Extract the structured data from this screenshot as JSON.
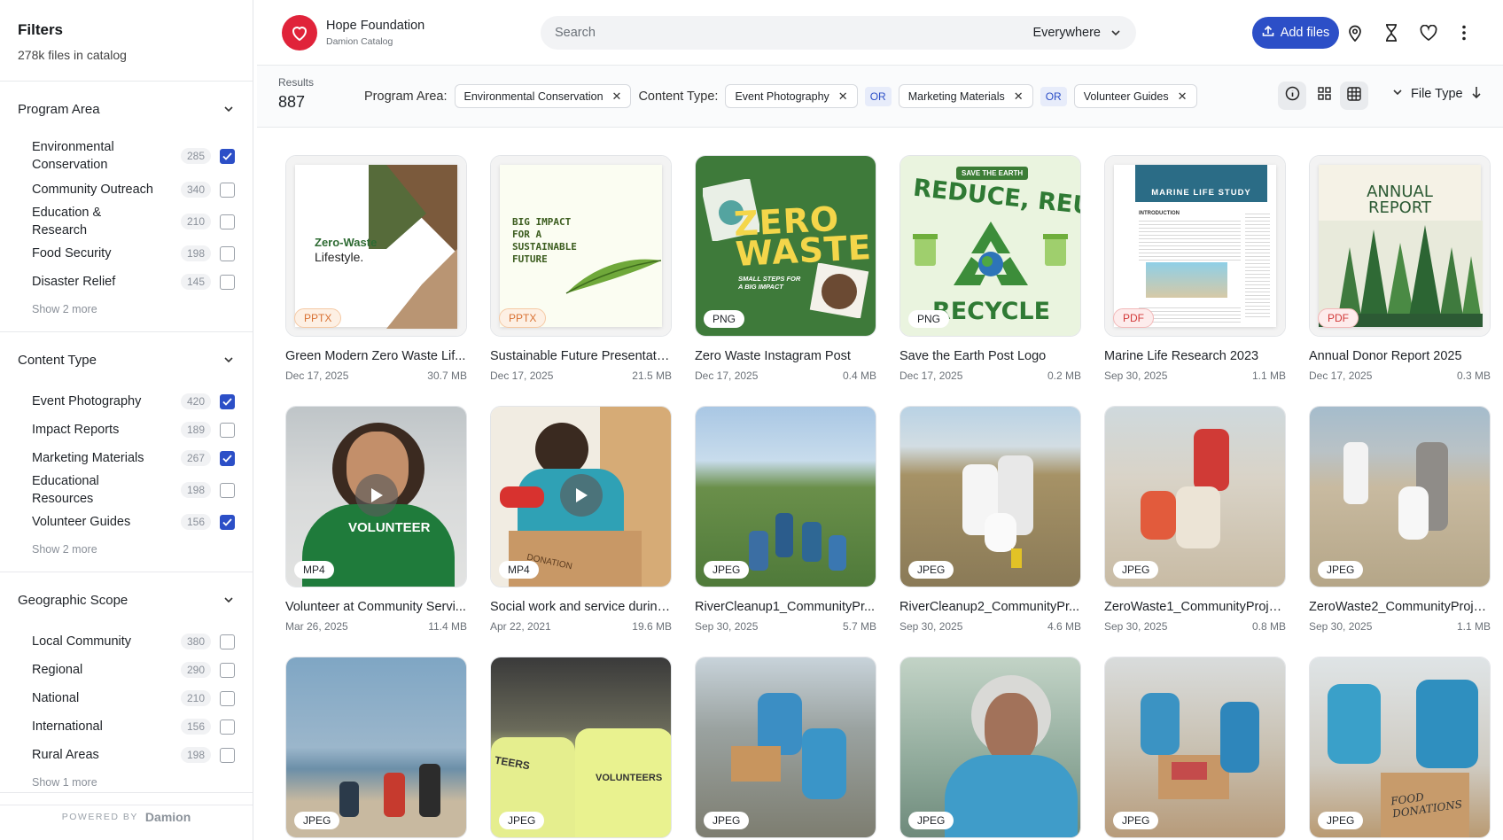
{
  "sidebar": {
    "title": "Filters",
    "subtitle": "278k files in catalog",
    "groups": [
      {
        "title": "Program Area",
        "items": [
          {
            "label": "Environmental Conservation",
            "count": "285",
            "checked": true
          },
          {
            "label": "Community Outreach",
            "count": "340",
            "checked": false
          },
          {
            "label": "Education & Research",
            "count": "210",
            "checked": false
          },
          {
            "label": "Food Security",
            "count": "198",
            "checked": false
          },
          {
            "label": "Disaster Relief",
            "count": "145",
            "checked": false
          }
        ],
        "more": "Show 2 more"
      },
      {
        "title": "Content Type",
        "items": [
          {
            "label": "Event Photography",
            "count": "420",
            "checked": true
          },
          {
            "label": "Impact Reports",
            "count": "189",
            "checked": false
          },
          {
            "label": "Marketing Materials",
            "count": "267",
            "checked": true
          },
          {
            "label": "Educational Resources",
            "count": "198",
            "checked": false
          },
          {
            "label": "Volunteer Guides",
            "count": "156",
            "checked": true
          }
        ],
        "more": "Show 2 more"
      },
      {
        "title": "Geographic Scope",
        "items": [
          {
            "label": "Local Community",
            "count": "380",
            "checked": false
          },
          {
            "label": "Regional",
            "count": "290",
            "checked": false
          },
          {
            "label": "National",
            "count": "210",
            "checked": false
          },
          {
            "label": "International",
            "count": "156",
            "checked": false
          },
          {
            "label": "Rural Areas",
            "count": "198",
            "checked": false
          }
        ],
        "more": "Show 1 more"
      }
    ],
    "footer": {
      "powered_by": "POWERED BY",
      "brand": "Damion"
    }
  },
  "header": {
    "org_name": "Hope Foundation",
    "catalog": "Damion Catalog",
    "search_placeholder": "Search",
    "scope": "Everywhere",
    "add_label": "Add files",
    "icons": [
      "location-pin-icon",
      "hourglass-icon",
      "heart-icon",
      "more-vertical-icon"
    ]
  },
  "filterbar": {
    "results_label": "Results",
    "results_count": "887",
    "program_label": "Program Area:",
    "program_chips": [
      "Environmental Conservation"
    ],
    "content_label": "Content Type:",
    "content_chips": [
      "Event Photography",
      "Marketing Materials",
      "Volunteer Guides"
    ],
    "or_label": "OR",
    "sort_label": "File Type"
  },
  "files": [
    {
      "name": "Green Modern Zero Waste Lif...",
      "date": "Dec 17, 2025",
      "size": "30.7 MB",
      "type": "PPTX",
      "thumb_text": [
        "Zero-Waste",
        "Lifestyle."
      ]
    },
    {
      "name": "Sustainable Future Presentation",
      "date": "Dec 17, 2025",
      "size": "21.5 MB",
      "type": "PPTX",
      "thumb_text": [
        "BIG IMPACT",
        "FOR A",
        "SUSTAINABLE",
        "FUTURE"
      ]
    },
    {
      "name": "Zero Waste Instagram Post",
      "date": "Dec 17, 2025",
      "size": "0.4 MB",
      "type": "PNG",
      "thumb_text": [
        "ZERO",
        "WASTE",
        "SMALL STEPS FOR",
        "A BIG IMPACT"
      ]
    },
    {
      "name": "Save the Earth Post Logo",
      "date": "Dec 17, 2025",
      "size": "0.2 MB",
      "type": "PNG",
      "thumb_text": [
        "SAVE THE EARTH",
        "REDUCE, REUSE",
        "RECYCLE"
      ]
    },
    {
      "name": "Marine Life Research 2023",
      "date": "Sep 30, 2025",
      "size": "1.1 MB",
      "type": "PDF",
      "thumb_text": [
        "MARINE LIFE STUDY",
        "INTRODUCTION"
      ]
    },
    {
      "name": "Annual Donor Report 2025",
      "date": "Dec 17, 2025",
      "size": "0.3 MB",
      "type": "PDF",
      "thumb_text": [
        "ANNUAL",
        "REPORT"
      ]
    },
    {
      "name": "Volunteer at Community Servi...",
      "date": "Mar 26, 2025",
      "size": "11.4 MB",
      "type": "MP4",
      "thumb_text": [
        "VOLUNTEER"
      ]
    },
    {
      "name": "Social work and service during...",
      "date": "Apr 22, 2021",
      "size": "19.6 MB",
      "type": "MP4",
      "thumb_text": [
        "DONATION"
      ]
    },
    {
      "name": "RiverCleanup1_CommunityPr...",
      "date": "Sep 30, 2025",
      "size": "5.7 MB",
      "type": "JPEG"
    },
    {
      "name": "RiverCleanup2_CommunityPr...",
      "date": "Sep 30, 2025",
      "size": "4.6 MB",
      "type": "JPEG"
    },
    {
      "name": "ZeroWaste1_CommunityProje...",
      "date": "Sep 30, 2025",
      "size": "0.8 MB",
      "type": "JPEG"
    },
    {
      "name": "ZeroWaste2_CommunityProje...",
      "date": "Sep 30, 2025",
      "size": "1.1 MB",
      "type": "JPEG"
    },
    {
      "name": "",
      "date": "",
      "size": "",
      "type": "JPEG"
    },
    {
      "name": "",
      "date": "",
      "size": "",
      "type": "JPEG",
      "thumb_text": [
        "TEERS",
        "VOLUNTEERS"
      ]
    },
    {
      "name": "",
      "date": "",
      "size": "",
      "type": "JPEG"
    },
    {
      "name": "",
      "date": "",
      "size": "",
      "type": "JPEG"
    },
    {
      "name": "",
      "date": "",
      "size": "",
      "type": "JPEG"
    },
    {
      "name": "",
      "date": "",
      "size": "",
      "type": "JPEG",
      "thumb_text": [
        "FOOD",
        "DONATIONS"
      ]
    }
  ],
  "colors": {
    "accent": "#2c4fc7",
    "brand": "#e0233a"
  }
}
